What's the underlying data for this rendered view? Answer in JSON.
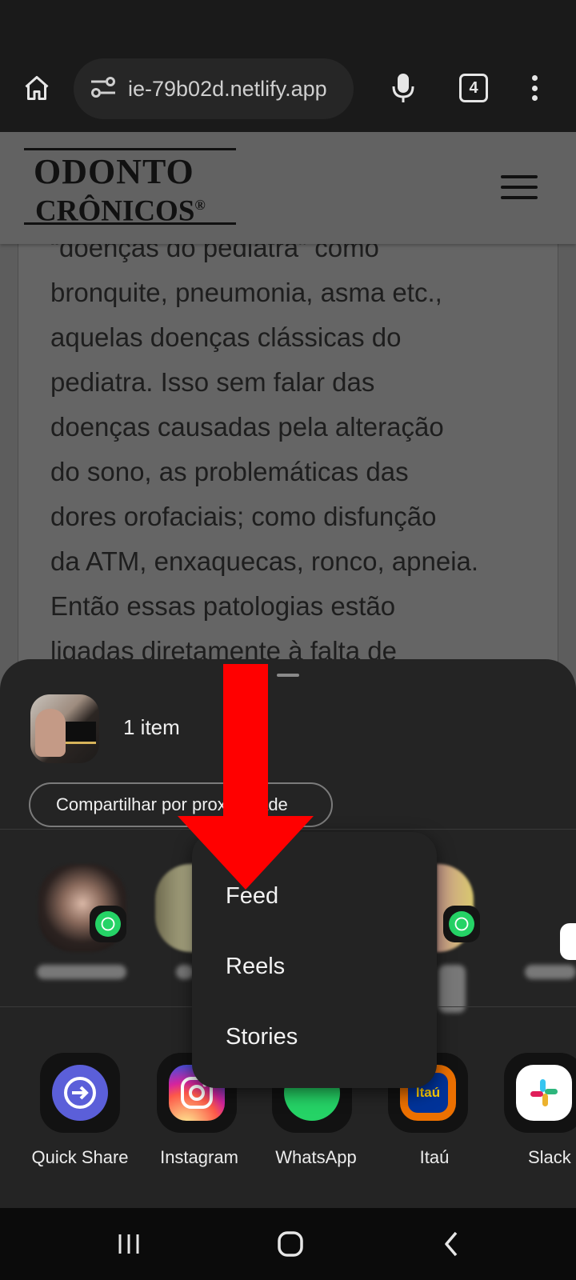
{
  "browser": {
    "url": "ie-79b02d.netlify.app",
    "tab_count": "4"
  },
  "site": {
    "logo_line1": "ODONTO",
    "logo_line2": "CRÔNICOS",
    "logo_reg": "®"
  },
  "article": {
    "lines": [
      "“doenças do pediatra” como",
      "bronquite, pneumonia, asma etc.,",
      "aquelas doenças clássicas do",
      "pediatra. Isso sem falar das",
      "doenças causadas pela alteração",
      "do sono, as problemáticas das",
      "dores orofaciais; como disfunção",
      "da ATM, enxaquecas, ronco, apneia.",
      "Então essas patologias estão",
      "ligadas diretamente à falta de"
    ]
  },
  "share_sheet": {
    "item_count": "1 item",
    "share_nearby_label": "Compartilhar por proximidade",
    "apps": [
      {
        "label": "Quick Share",
        "icon": "quick-share-icon",
        "color": "#5b5fd9"
      },
      {
        "label": "Instagram",
        "icon": "instagram-icon",
        "color": "#e1306c"
      },
      {
        "label": "WhatsApp",
        "icon": "whatsapp-icon",
        "color": "#25d366"
      },
      {
        "label": "Itaú",
        "icon": "itau-icon",
        "color": "#ec7000"
      },
      {
        "label": "Slack",
        "icon": "slack-icon",
        "color": "#ffffff"
      }
    ]
  },
  "instagram_menu": {
    "items": [
      "Feed",
      "Reels",
      "Stories"
    ]
  },
  "colors": {
    "annotation_arrow": "#ff0000",
    "sheet_bg": "#242424"
  }
}
